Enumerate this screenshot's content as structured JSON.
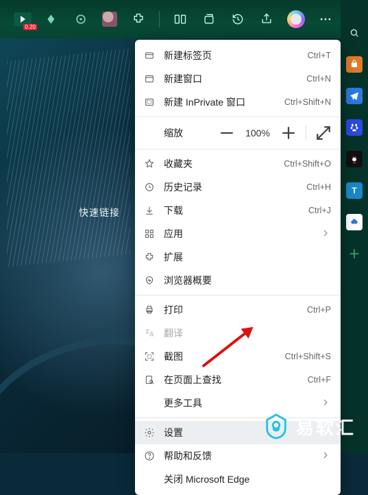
{
  "quicklinks_label": "快速链接",
  "topbar": {
    "badge": "0.20"
  },
  "menu": {
    "new_tab": "新建标签页",
    "new_tab_sc": "Ctrl+T",
    "new_window": "新建窗口",
    "new_window_sc": "Ctrl+N",
    "new_inprivate": "新建 InPrivate 窗口",
    "new_inprivate_sc": "Ctrl+Shift+N",
    "zoom_label": "缩放",
    "zoom_value": "100%",
    "favorites": "收藏夹",
    "favorites_sc": "Ctrl+Shift+O",
    "history": "历史记录",
    "history_sc": "Ctrl+H",
    "downloads": "下载",
    "downloads_sc": "Ctrl+J",
    "apps": "应用",
    "extensions": "扩展",
    "essentials": "浏览器概要",
    "print": "打印",
    "print_sc": "Ctrl+P",
    "translate": "翻译",
    "screenshot": "截图",
    "screenshot_sc": "Ctrl+Shift+S",
    "find": "在页面上查找",
    "find_sc": "Ctrl+F",
    "more_tools": "更多工具",
    "settings": "设置",
    "help": "帮助和反馈",
    "close_edge": "关闭 Microsoft Edge"
  },
  "watermark": "易软汇"
}
